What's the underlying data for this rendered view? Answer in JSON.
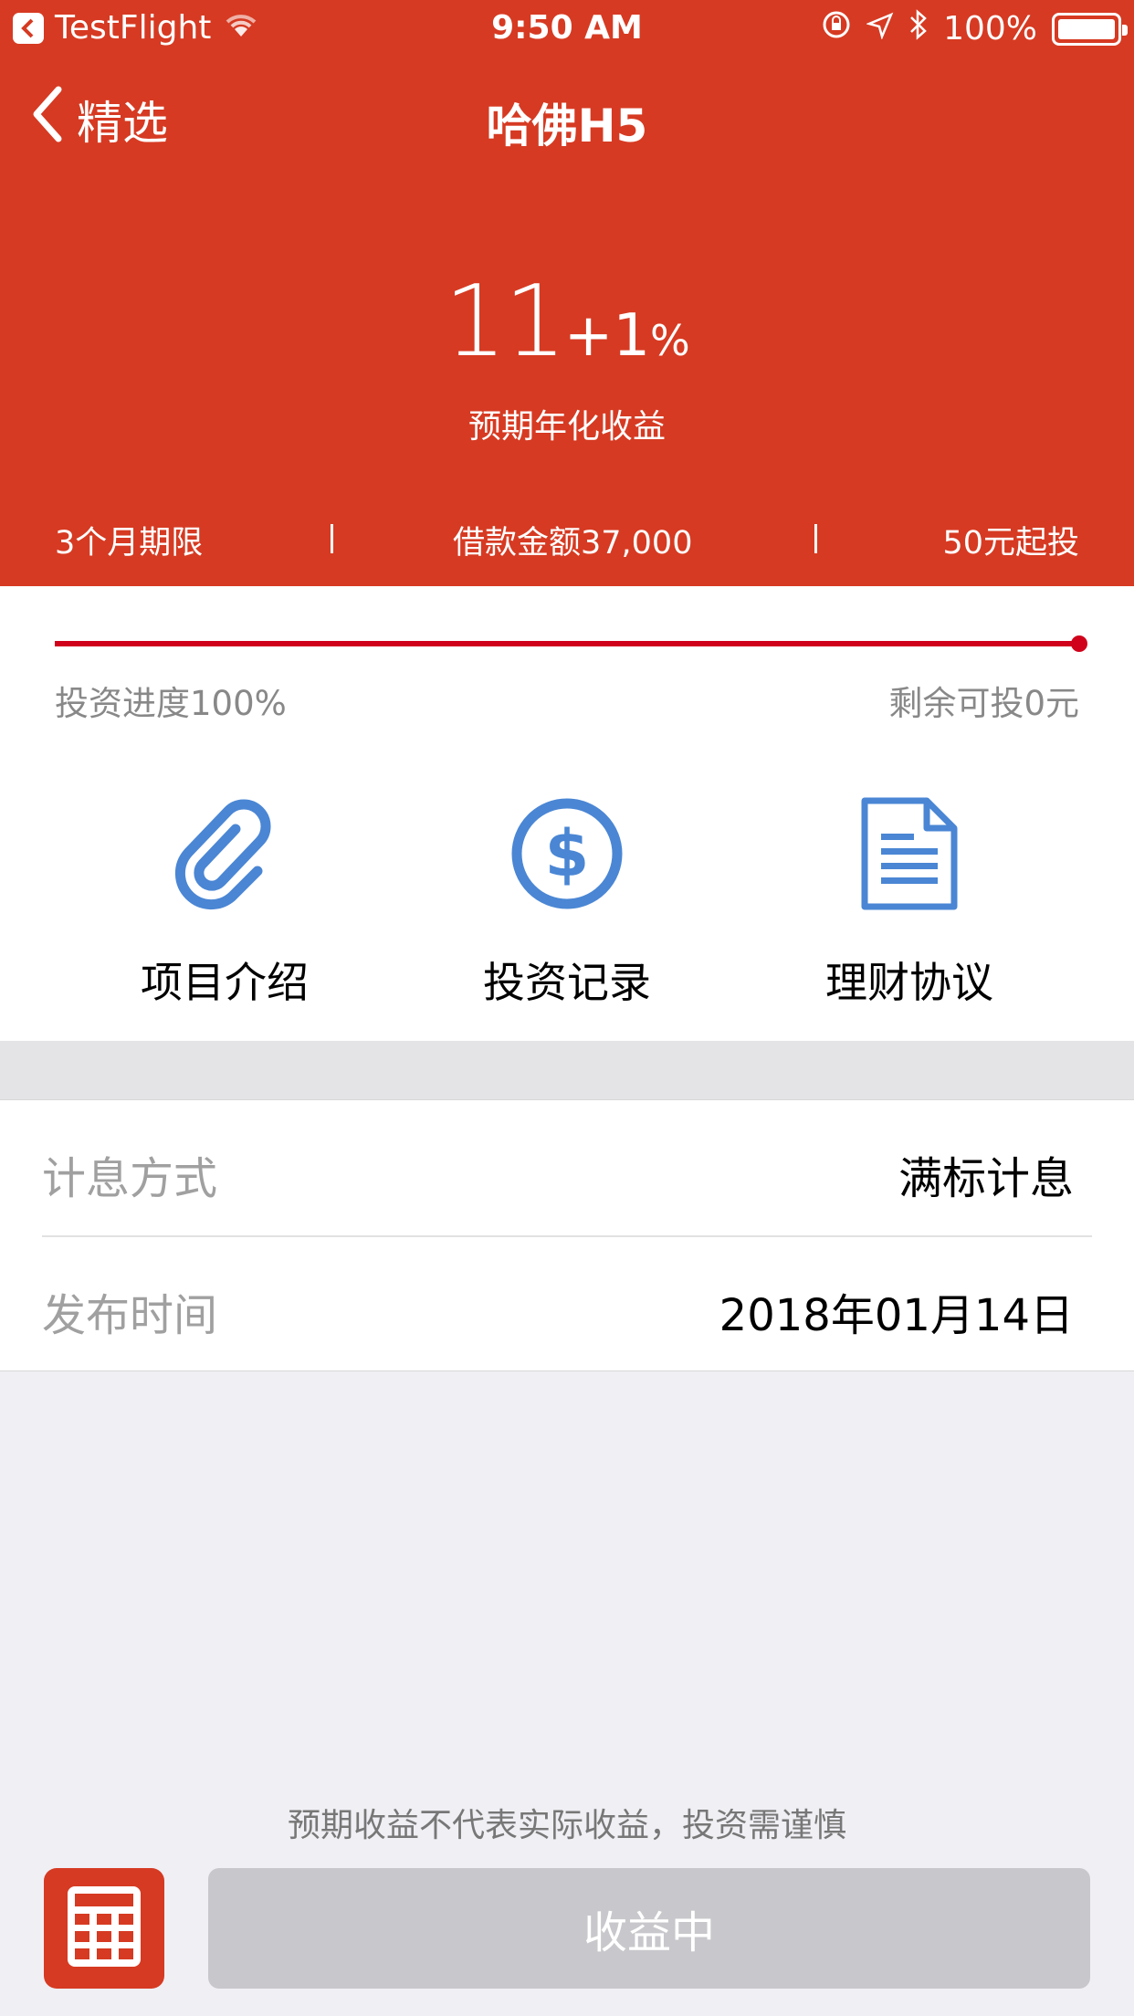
{
  "status_bar": {
    "carrier": "TestFlight",
    "time": "9:50 AM",
    "battery": "100%"
  },
  "nav": {
    "back_label": "精选",
    "title": "哈佛H5"
  },
  "rate": {
    "base": "11",
    "bonus": "+1",
    "unit": "%",
    "label": "预期年化收益"
  },
  "specs": {
    "term": "3个月期限",
    "amount": "借款金额37,000",
    "min_invest": "50元起投"
  },
  "progress": {
    "value": 1.0,
    "left_label": "投资进度100%",
    "right_label": "剩余可投0元"
  },
  "actions": [
    {
      "label": "项目介绍",
      "icon": "paperclip-icon"
    },
    {
      "label": "投资记录",
      "icon": "dollar-coin-icon"
    },
    {
      "label": "理财协议",
      "icon": "document-icon"
    }
  ],
  "details": [
    {
      "key": "计息方式",
      "value": "满标计息"
    },
    {
      "key": "发布时间",
      "value": "2018年01月14日"
    }
  ],
  "footer": {
    "disclaimer": "预期收益不代表实际收益，投资需谨慎",
    "button_label": "收益中",
    "calculator_icon": "calculator-icon"
  },
  "colors": {
    "brand_red": "#d63a22",
    "progress_red": "#d0021b",
    "icon_blue": "#4a86d4",
    "disabled_button": "#c8c8cc"
  }
}
